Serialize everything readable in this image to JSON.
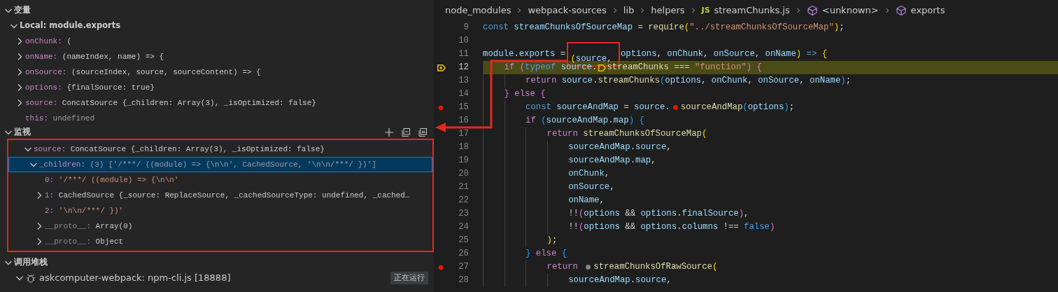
{
  "variables": {
    "title": "变量",
    "expanded": true,
    "scopes": [
      {
        "label": "Local: module.exports",
        "expanded": true,
        "items": [
          {
            "name": "onChunk:",
            "value": "(",
            "kind": "function",
            "expanded": false
          },
          {
            "name": "onName:",
            "value": "(nameIndex, name) => {",
            "kind": "function",
            "expanded": false
          },
          {
            "name": "onSource:",
            "value": "(sourceIndex, source, sourceContent) => {",
            "kind": "function",
            "expanded": false
          },
          {
            "name": "options:",
            "value": "{finalSource: true}",
            "kind": "object",
            "expanded": false
          },
          {
            "name": "source:",
            "value": "ConcatSource {_children: Array(3), _isOptimized: false}",
            "kind": "object",
            "expanded": false
          },
          {
            "name": "this:",
            "value": "undefined",
            "kind": "undefined"
          }
        ]
      }
    ]
  },
  "watch": {
    "title": "监视",
    "expanded": true,
    "items": [
      {
        "name": "source:",
        "value": "ConcatSource {_children: Array(3), _isOptimized: false}",
        "kind": "object",
        "expanded": true,
        "selected": false,
        "children": [
          {
            "name": "_children:",
            "value": "(3) ['/***/ ((module) => {\\n\\n', CachedSource, '\\n\\n/***/ })']",
            "expanded": true,
            "selected": true,
            "children": [
              {
                "name": "0:",
                "value": "'/***/ ((module) => {\\n\\n'",
                "kind": "string",
                "selected": false
              },
              {
                "name": "1:",
                "value": "CachedSource {_source: ReplaceSource, _cachedSourceType: undefined, _cached…",
                "kind": "object",
                "expanded": false,
                "selected": false
              },
              {
                "name": "2:",
                "value": "'\\n\\n/***/ })'",
                "kind": "string",
                "selected": false
              },
              {
                "name": "__proto__:",
                "value": "Array(0)",
                "kind": "object",
                "internal": true,
                "expanded": false,
                "selected": false
              },
              {
                "name": "__proto__:",
                "value": "Object",
                "kind": "object",
                "internal": true,
                "expanded": false,
                "selected": false
              }
            ]
          }
        ]
      }
    ]
  },
  "call_stack": {
    "title": "调用堆栈",
    "expanded": true,
    "sessions": [
      {
        "name": "askcomputer-webpack: npm-cli.js [18888]",
        "status": "正在运行",
        "expanded": true
      }
    ]
  },
  "breadcrumb": [
    {
      "text": "node_modules",
      "kind": "folder"
    },
    {
      "text": "webpack-sources",
      "kind": "folder"
    },
    {
      "text": "lib",
      "kind": "folder"
    },
    {
      "text": "helpers",
      "kind": "folder"
    },
    {
      "text": "streamChunks.js",
      "kind": "file",
      "badge": "JS"
    },
    {
      "text": "<unknown>",
      "kind": "symbol"
    },
    {
      "text": "exports",
      "kind": "symbol"
    }
  ],
  "code": [
    {
      "number": "9",
      "kind": "normal",
      "tokens": [
        {
          "kind": "kw",
          "text": "const "
        },
        {
          "kind": "var",
          "text": "streamChunksOfSourceMap"
        },
        {
          "kind": "plain",
          "text": " = "
        },
        {
          "kind": "fn",
          "text": "require"
        },
        {
          "kind": "b1",
          "text": "("
        },
        {
          "kind": "str",
          "text": "\"../streamChunksOfSourceMap\""
        },
        {
          "kind": "b1",
          "text": ")"
        },
        {
          "kind": "plain",
          "text": ";"
        }
      ]
    },
    {
      "number": "10",
      "kind": "normal"
    },
    {
      "number": "11",
      "kind": "normal",
      "tokens": [
        {
          "kind": "var",
          "text": "module"
        },
        {
          "kind": "plain",
          "text": "."
        },
        {
          "kind": "var",
          "text": "exports"
        },
        {
          "kind": "plain",
          "text": " = "
        },
        {
          "kind": "b1",
          "text": "("
        },
        {
          "kind": "var",
          "text": "source"
        },
        {
          "kind": "plain",
          "text": ", "
        },
        {
          "kind": "var",
          "text": "options"
        },
        {
          "kind": "plain",
          "text": ", "
        },
        {
          "kind": "var",
          "text": "onChunk"
        },
        {
          "kind": "plain",
          "text": ", "
        },
        {
          "kind": "var",
          "text": "onSource"
        },
        {
          "kind": "plain",
          "text": ", "
        },
        {
          "kind": "var",
          "text": "onName"
        },
        {
          "kind": "b1",
          "text": ")"
        },
        {
          "kind": "kw",
          "text": " => "
        },
        {
          "kind": "b1",
          "text": "{"
        }
      ]
    },
    {
      "number": "12",
      "kind": "current",
      "tokens": [
        {
          "kind": "ctl",
          "text": "    if "
        },
        {
          "kind": "b2",
          "text": "("
        },
        {
          "kind": "kw",
          "text": "typeof "
        },
        {
          "kind": "var",
          "text": "source"
        },
        {
          "kind": "plain",
          "text": "."
        },
        {
          "kind": "current-stop"
        },
        {
          "kind": "fn",
          "text": "streamChunks"
        },
        {
          "kind": "plain",
          "text": " === "
        },
        {
          "kind": "str",
          "text": "\"function\""
        },
        {
          "kind": "b2",
          "text": ")"
        },
        {
          "kind": "b2",
          "text": " {"
        }
      ]
    },
    {
      "number": "13",
      "kind": "normal",
      "tokens": [
        {
          "kind": "ctl",
          "text": "        return "
        },
        {
          "kind": "var",
          "text": "source"
        },
        {
          "kind": "plain",
          "text": "."
        },
        {
          "kind": "fn",
          "text": "streamChunks"
        },
        {
          "kind": "b3",
          "text": "("
        },
        {
          "kind": "var",
          "text": "options"
        },
        {
          "kind": "plain",
          "text": ", "
        },
        {
          "kind": "var",
          "text": "onChunk"
        },
        {
          "kind": "plain",
          "text": ", "
        },
        {
          "kind": "var",
          "text": "onSource"
        },
        {
          "kind": "plain",
          "text": ", "
        },
        {
          "kind": "var",
          "text": "onName"
        },
        {
          "kind": "b3",
          "text": ")"
        },
        {
          "kind": "plain",
          "text": ";"
        }
      ]
    },
    {
      "number": "14",
      "kind": "normal",
      "tokens": [
        {
          "kind": "b2",
          "text": "    }"
        },
        {
          "kind": "ctl",
          "text": " else "
        },
        {
          "kind": "b2",
          "text": "{"
        }
      ]
    },
    {
      "number": "15",
      "kind": "breakpoint",
      "tokens": [
        {
          "kind": "kw",
          "text": "        const "
        },
        {
          "kind": "var",
          "text": "sourceAndMap"
        },
        {
          "kind": "plain",
          "text": " = "
        },
        {
          "kind": "var",
          "text": "source"
        },
        {
          "kind": "plain",
          "text": "."
        },
        {
          "kind": "inline-breakpoint",
          "enabled": true
        },
        {
          "kind": "fn",
          "text": "sourceAndMap"
        },
        {
          "kind": "b3",
          "text": "("
        },
        {
          "kind": "var",
          "text": "options"
        },
        {
          "kind": "b3",
          "text": ")"
        },
        {
          "kind": "plain",
          "text": ";"
        }
      ]
    },
    {
      "number": "16",
      "kind": "normal",
      "tokens": [
        {
          "kind": "ctl",
          "text": "        if "
        },
        {
          "kind": "b3",
          "text": "("
        },
        {
          "kind": "var",
          "text": "sourceAndMap"
        },
        {
          "kind": "plain",
          "text": "."
        },
        {
          "kind": "var",
          "text": "map"
        },
        {
          "kind": "b3",
          "text": ")"
        },
        {
          "kind": "b3",
          "text": " {"
        }
      ]
    },
    {
      "number": "17",
      "kind": "normal",
      "tokens": [
        {
          "kind": "ctl",
          "text": "            return "
        },
        {
          "kind": "fn",
          "text": "streamChunksOfSourceMap"
        },
        {
          "kind": "b1",
          "text": "("
        }
      ]
    },
    {
      "number": "18",
      "kind": "normal",
      "tokens": [
        {
          "kind": "var",
          "text": "                sourceAndMap"
        },
        {
          "kind": "plain",
          "text": "."
        },
        {
          "kind": "var",
          "text": "source"
        },
        {
          "kind": "plain",
          "text": ","
        }
      ]
    },
    {
      "number": "19",
      "kind": "normal",
      "tokens": [
        {
          "kind": "var",
          "text": "                sourceAndMap"
        },
        {
          "kind": "plain",
          "text": "."
        },
        {
          "kind": "var",
          "text": "map"
        },
        {
          "kind": "plain",
          "text": ","
        }
      ]
    },
    {
      "number": "20",
      "kind": "normal",
      "tokens": [
        {
          "kind": "var",
          "text": "                onChunk"
        },
        {
          "kind": "plain",
          "text": ","
        }
      ]
    },
    {
      "number": "21",
      "kind": "normal",
      "tokens": [
        {
          "kind": "var",
          "text": "                onSource"
        },
        {
          "kind": "plain",
          "text": ","
        }
      ]
    },
    {
      "number": "22",
      "kind": "normal",
      "tokens": [
        {
          "kind": "var",
          "text": "                onName"
        },
        {
          "kind": "plain",
          "text": ","
        }
      ]
    },
    {
      "number": "23",
      "kind": "normal",
      "tokens": [
        {
          "kind": "plain",
          "text": "                !!"
        },
        {
          "kind": "b2",
          "text": "("
        },
        {
          "kind": "var",
          "text": "options"
        },
        {
          "kind": "plain",
          "text": " && "
        },
        {
          "kind": "var",
          "text": "options"
        },
        {
          "kind": "plain",
          "text": "."
        },
        {
          "kind": "var",
          "text": "finalSource"
        },
        {
          "kind": "b2",
          "text": ")"
        },
        {
          "kind": "plain",
          "text": ","
        }
      ]
    },
    {
      "number": "24",
      "kind": "normal",
      "tokens": [
        {
          "kind": "plain",
          "text": "                !!"
        },
        {
          "kind": "b2",
          "text": "("
        },
        {
          "kind": "var",
          "text": "options"
        },
        {
          "kind": "plain",
          "text": " && "
        },
        {
          "kind": "var",
          "text": "options"
        },
        {
          "kind": "plain",
          "text": "."
        },
        {
          "kind": "var",
          "text": "columns"
        },
        {
          "kind": "plain",
          "text": " !== "
        },
        {
          "kind": "kw",
          "text": "false"
        },
        {
          "kind": "b2",
          "text": ")"
        }
      ]
    },
    {
      "number": "25",
      "kind": "normal",
      "tokens": [
        {
          "kind": "b1",
          "text": "            )"
        },
        {
          "kind": "plain",
          "text": ";"
        }
      ]
    },
    {
      "number": "26",
      "kind": "normal",
      "tokens": [
        {
          "kind": "b3",
          "text": "        }"
        },
        {
          "kind": "ctl",
          "text": " else "
        },
        {
          "kind": "b3",
          "text": "{"
        }
      ]
    },
    {
      "number": "27",
      "kind": "breakpoint",
      "tokens": [
        {
          "kind": "ctl",
          "text": "            return "
        },
        {
          "kind": "inline-breakpoint",
          "enabled": false
        },
        {
          "kind": "fn",
          "text": "streamChunksOfRawSource"
        },
        {
          "kind": "b1",
          "text": "("
        }
      ]
    },
    {
      "number": "28",
      "kind": "normal",
      "tokens": [
        {
          "kind": "var",
          "text": "                sourceAndMap"
        },
        {
          "kind": "plain",
          "text": "."
        },
        {
          "kind": "var",
          "text": "source"
        },
        {
          "kind": "plain",
          "text": ","
        }
      ]
    }
  ]
}
